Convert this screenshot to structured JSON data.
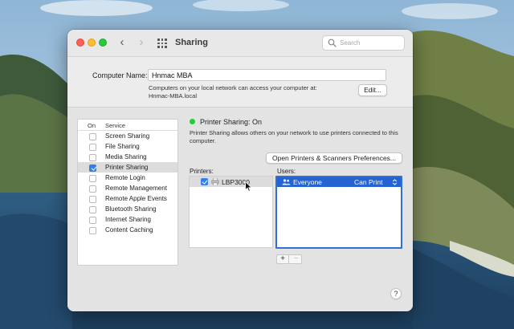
{
  "window": {
    "title": "Sharing",
    "search_placeholder": "Search"
  },
  "computer_name": {
    "label": "Computer Name:",
    "value": "Hnmac MBA",
    "note": "Computers on your local network can access your computer at:",
    "hostname": "Hnmac-MBA.local",
    "edit_label": "Edit..."
  },
  "services": {
    "header_on": "On",
    "header_service": "Service",
    "items": [
      {
        "label": "Screen Sharing",
        "on": false
      },
      {
        "label": "File Sharing",
        "on": false
      },
      {
        "label": "Media Sharing",
        "on": false
      },
      {
        "label": "Printer Sharing",
        "on": true,
        "selected": true
      },
      {
        "label": "Remote Login",
        "on": false
      },
      {
        "label": "Remote Management",
        "on": false
      },
      {
        "label": "Remote Apple Events",
        "on": false
      },
      {
        "label": "Bluetooth Sharing",
        "on": false
      },
      {
        "label": "Internet Sharing",
        "on": false
      },
      {
        "label": "Content Caching",
        "on": false
      }
    ]
  },
  "status": {
    "text": "Printer Sharing: On",
    "color": "#27c93f",
    "description": "Printer Sharing allows others on your network to use printers connected to this computer."
  },
  "open_prefs_label": "Open Printers & Scanners Preferences...",
  "printers": {
    "label": "Printers:",
    "items": [
      {
        "name": "LBP3000",
        "checked": true
      }
    ]
  },
  "users": {
    "label": "Users:",
    "items": [
      {
        "name": "Everyone",
        "permission": "Can Print"
      }
    ],
    "add_label": "+",
    "remove_label": "−"
  },
  "help_label": "?",
  "colors": {
    "accent": "#2463d1",
    "status_on": "#27c93f"
  }
}
